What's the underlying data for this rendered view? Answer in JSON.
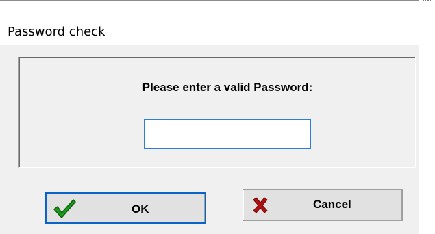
{
  "window": {
    "title": "Password check"
  },
  "dialog": {
    "prompt": "Please enter a valid Password:",
    "password_input": {
      "value": "",
      "placeholder": ""
    }
  },
  "buttons": {
    "ok": {
      "label": "OK",
      "icon": "green-checkmark-icon",
      "icon_color": "#1a9c1a"
    },
    "cancel": {
      "label": "Cancel",
      "icon": "red-x-icon",
      "icon_color": "#b01010"
    }
  },
  "colors": {
    "focus_border": "#2d7fd6",
    "dialog_background": "#f0f0f0",
    "button_face": "#e1e1e1"
  }
}
